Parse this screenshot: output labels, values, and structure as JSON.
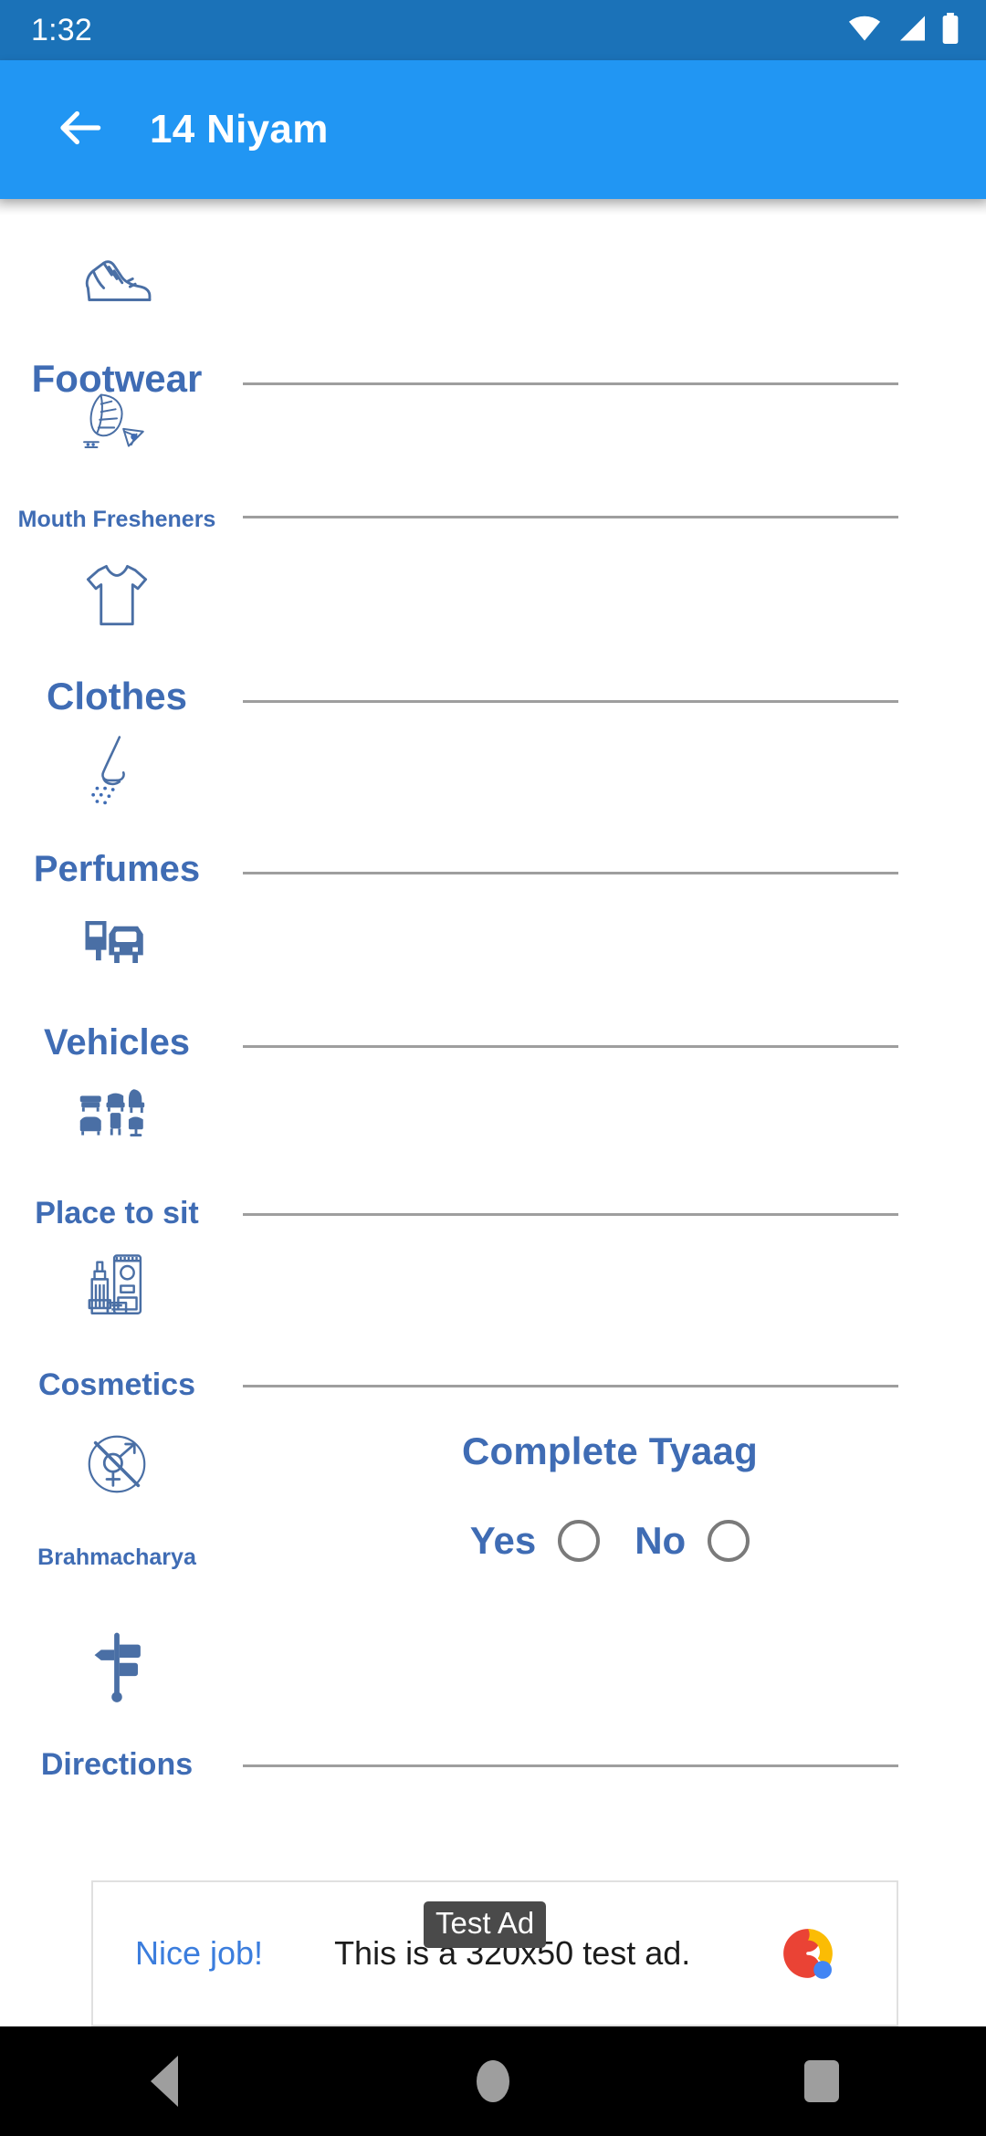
{
  "statusbar": {
    "time": "1:32",
    "icons": [
      "wifi-icon",
      "signal-icon",
      "battery-icon"
    ]
  },
  "appbar": {
    "back_icon": "arrow-left-icon",
    "title": "14 Niyam",
    "background": "#2196f3"
  },
  "theme": {
    "primary": "#2196f3",
    "status_bar": "#1b72b8",
    "label_blue": "#3f6cb4",
    "divider_gray": "#9e9e9e"
  },
  "niyam_items": [
    {
      "label": "Footwear",
      "icon": "shoe-icon",
      "size": "lab-xl"
    },
    {
      "label": "Mouth Fresheners",
      "icon": "leaf-icon",
      "size": "lab-xs"
    },
    {
      "label": "Clothes",
      "icon": "tshirt-icon",
      "size": "lab-xl"
    },
    {
      "label": "Perfumes",
      "icon": "nose-icon",
      "size": "lab-lg"
    },
    {
      "label": "Vehicles",
      "icon": "vehicle-icon",
      "size": "lab-lg"
    },
    {
      "label": "Place to sit",
      "icon": "seating-icon",
      "size": "lab-md"
    },
    {
      "label": "Cosmetics",
      "icon": "cosmetics-icon",
      "size": "lab-md"
    },
    {
      "label": "Brahmacharya",
      "icon": "celibacy-icon",
      "size": "lab-xs"
    },
    {
      "label": "Directions",
      "icon": "signpost-icon",
      "size": "lab-md"
    }
  ],
  "tyaag": {
    "title": "Complete Tyaag",
    "yes_label": "Yes",
    "no_label": "No",
    "yes_selected": false,
    "no_selected": false
  },
  "ad": {
    "tag": "Test Ad",
    "cta": "Nice job!",
    "body": "This is a 320x50 test ad.",
    "logo": "admob-logo"
  },
  "navbar": {
    "back": "nav-back-icon",
    "home": "nav-home-icon",
    "recents": "nav-recents-icon"
  }
}
